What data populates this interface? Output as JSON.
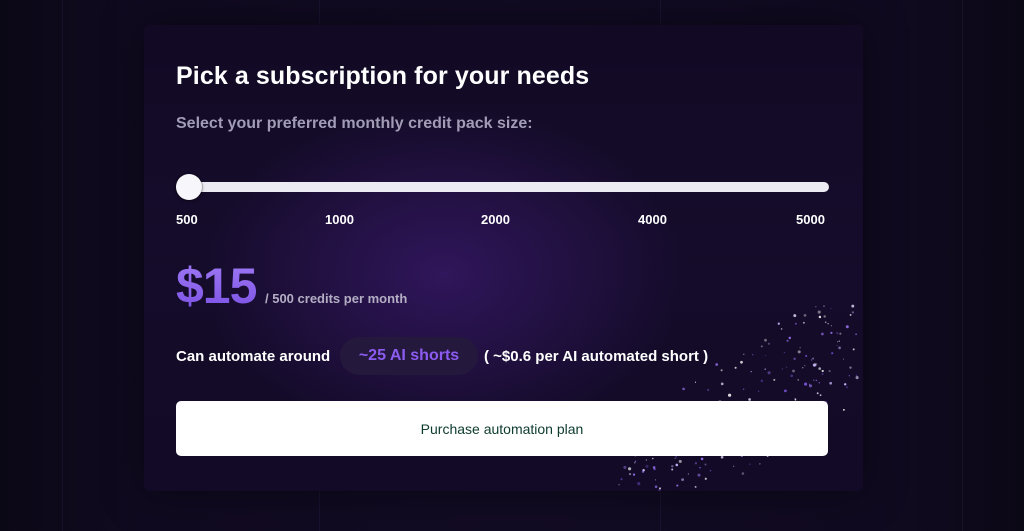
{
  "card": {
    "title": "Pick a subscription for your needs",
    "subtitle": "Select your preferred monthly credit pack size:"
  },
  "slider": {
    "ticks": [
      "500",
      "1000",
      "2000",
      "4000",
      "5000"
    ],
    "selected_value": 500
  },
  "pricing": {
    "price": "$15",
    "per_period": "/ 500 credits per month"
  },
  "automation": {
    "label": "Can automate around",
    "shorts_badge": "~25 AI shorts",
    "per_short": "( ~$0.6 per AI automated short )"
  },
  "purchase_button": {
    "label": "Purchase automation plan"
  },
  "colors": {
    "accent": "#8c5cf2",
    "background": "#0a0714",
    "card": "#140b28",
    "button_text": "#0d3b2e"
  }
}
